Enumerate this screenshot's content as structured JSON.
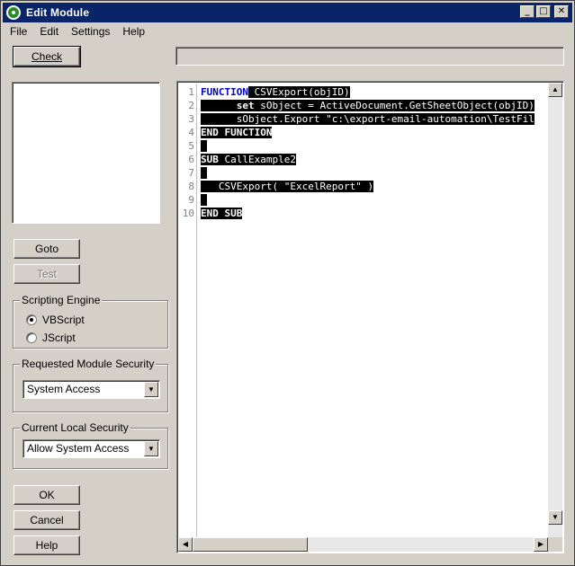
{
  "window": {
    "title": "Edit Module"
  },
  "menu": [
    "File",
    "Edit",
    "Settings",
    "Help"
  ],
  "buttons": {
    "check": "Check",
    "goto": "Goto",
    "test": "Test",
    "ok": "OK",
    "cancel": "Cancel",
    "help": "Help"
  },
  "scripting_engine": {
    "label": "Scripting Engine",
    "options": [
      "VBScript",
      "JScript"
    ],
    "selected": "VBScript"
  },
  "requested_security": {
    "label": "Requested Module Security",
    "value": "System Access"
  },
  "local_security": {
    "label": "Current Local Security",
    "value": "Allow System Access"
  },
  "editor": {
    "line_numbers": [
      "1",
      "2",
      "3",
      "4",
      "5",
      "6",
      "7",
      "8",
      "9",
      "10"
    ],
    "lines": [
      {
        "kw": "FUNCTION",
        "rest": " CSVExport(objID)"
      },
      {
        "indent": "      ",
        "kw": "set",
        "rest": " sObject = ActiveDocument.GetSheetObject(objID)"
      },
      {
        "indent": "      ",
        "kw": "",
        "rest": "sObject.Export \"c:\\export-email-automation\\TestFil"
      },
      {
        "kw": "END FUNCTION",
        "rest": ""
      },
      {
        "kw": "",
        "rest": " "
      },
      {
        "kw": "SUB",
        "rest": " CallExample2"
      },
      {
        "kw": "",
        "rest": " "
      },
      {
        "indent": "   ",
        "kw": "",
        "rest": "CSVExport( \"ExcelReport\" )"
      },
      {
        "kw": "",
        "rest": " "
      },
      {
        "kw": "END SUB",
        "rest": ""
      }
    ]
  }
}
